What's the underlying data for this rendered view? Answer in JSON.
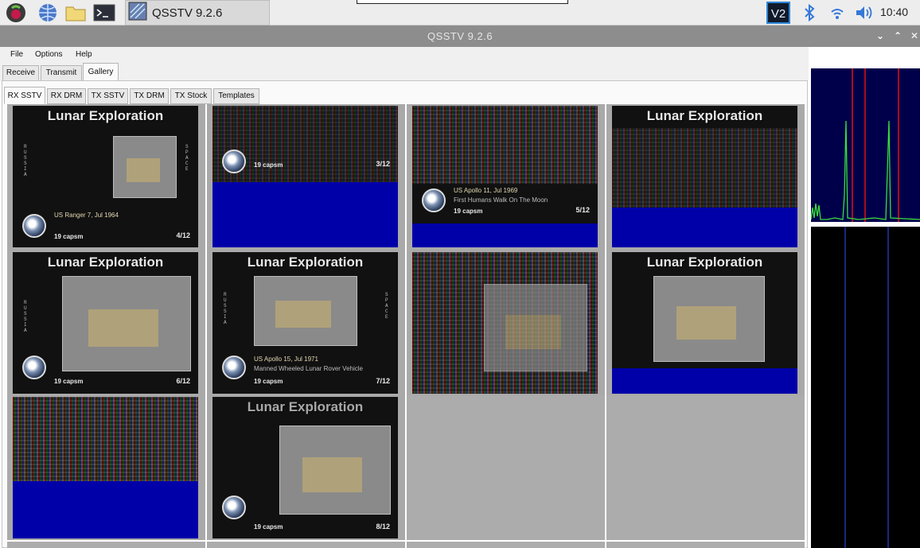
{
  "taskbar": {
    "icons": [
      "raspberry-menu-icon",
      "web-browser-icon",
      "file-manager-icon",
      "terminal-icon"
    ],
    "active_app": {
      "label": "QSSTV 9.2.6",
      "icon": "qsstv-app-icon"
    },
    "tray": [
      "vnc-icon",
      "bluetooth-icon",
      "wifi-icon",
      "volume-icon"
    ],
    "clock": "10:40"
  },
  "window": {
    "title": "QSSTV 9.2.6",
    "controls": [
      "minimize",
      "maximize",
      "close"
    ]
  },
  "menu": {
    "items": [
      "File",
      "Options",
      "Help"
    ]
  },
  "main_tabs": {
    "items": [
      "Receive",
      "Transmit",
      "Gallery"
    ],
    "active": "Gallery"
  },
  "sub_tabs": {
    "items": [
      "RX SSTV",
      "RX DRM",
      "TX SSTV",
      "TX DRM",
      "TX Stock",
      "Templates"
    ],
    "active": "RX SSTV"
  },
  "gallery": {
    "cells": [
      {
        "title": "Lunar Exploration",
        "caption": "US Ranger 7, Jul 1964",
        "ttl": "19 capsm",
        "count": "4/12",
        "style": "full"
      },
      {
        "title": "",
        "caption": "",
        "ttl": "19 capsm",
        "count": "3/12",
        "style": "partial"
      },
      {
        "title": "",
        "caption": "US Apollo 11, Jul 1969",
        "caption2": "First Humans Walk On The Moon",
        "ttl": "19 capsm",
        "count": "5/12",
        "style": "partial2"
      },
      {
        "title": "Lunar Exploration",
        "caption": "",
        "ttl": "",
        "count": "",
        "style": "partial3"
      },
      {
        "title": "Lunar Exploration",
        "caption": "",
        "ttl": "19 capsm",
        "count": "6/12",
        "style": "full2"
      },
      {
        "title": "Lunar Exploration",
        "caption": "US Apollo 15, Jul 1971",
        "caption2": "Manned Wheeled Lunar Rover Vehicle",
        "ttl": "19 capsm",
        "count": "7/12",
        "style": "full"
      },
      {
        "title": "",
        "caption": "",
        "ttl": "",
        "count": "",
        "style": "noisy"
      },
      {
        "title": "Lunar Exploration",
        "caption": "",
        "ttl": "",
        "count": "",
        "style": "partial3"
      },
      {
        "title": "",
        "caption": "",
        "ttl": "",
        "count": "",
        "style": "noise-blue"
      },
      {
        "title": "Lunar Exploration",
        "caption": "",
        "ttl": "19 capsm",
        "count": "8/12",
        "style": "full2"
      }
    ]
  },
  "colors": {
    "panel_bg": "#fafafa",
    "gallery_cell": "#a9a9a9",
    "waterfall_spectrum": "#00004a",
    "signal_green": "#3adf3a",
    "marker_red": "#e01010",
    "marker_blue": "#3050ff"
  }
}
